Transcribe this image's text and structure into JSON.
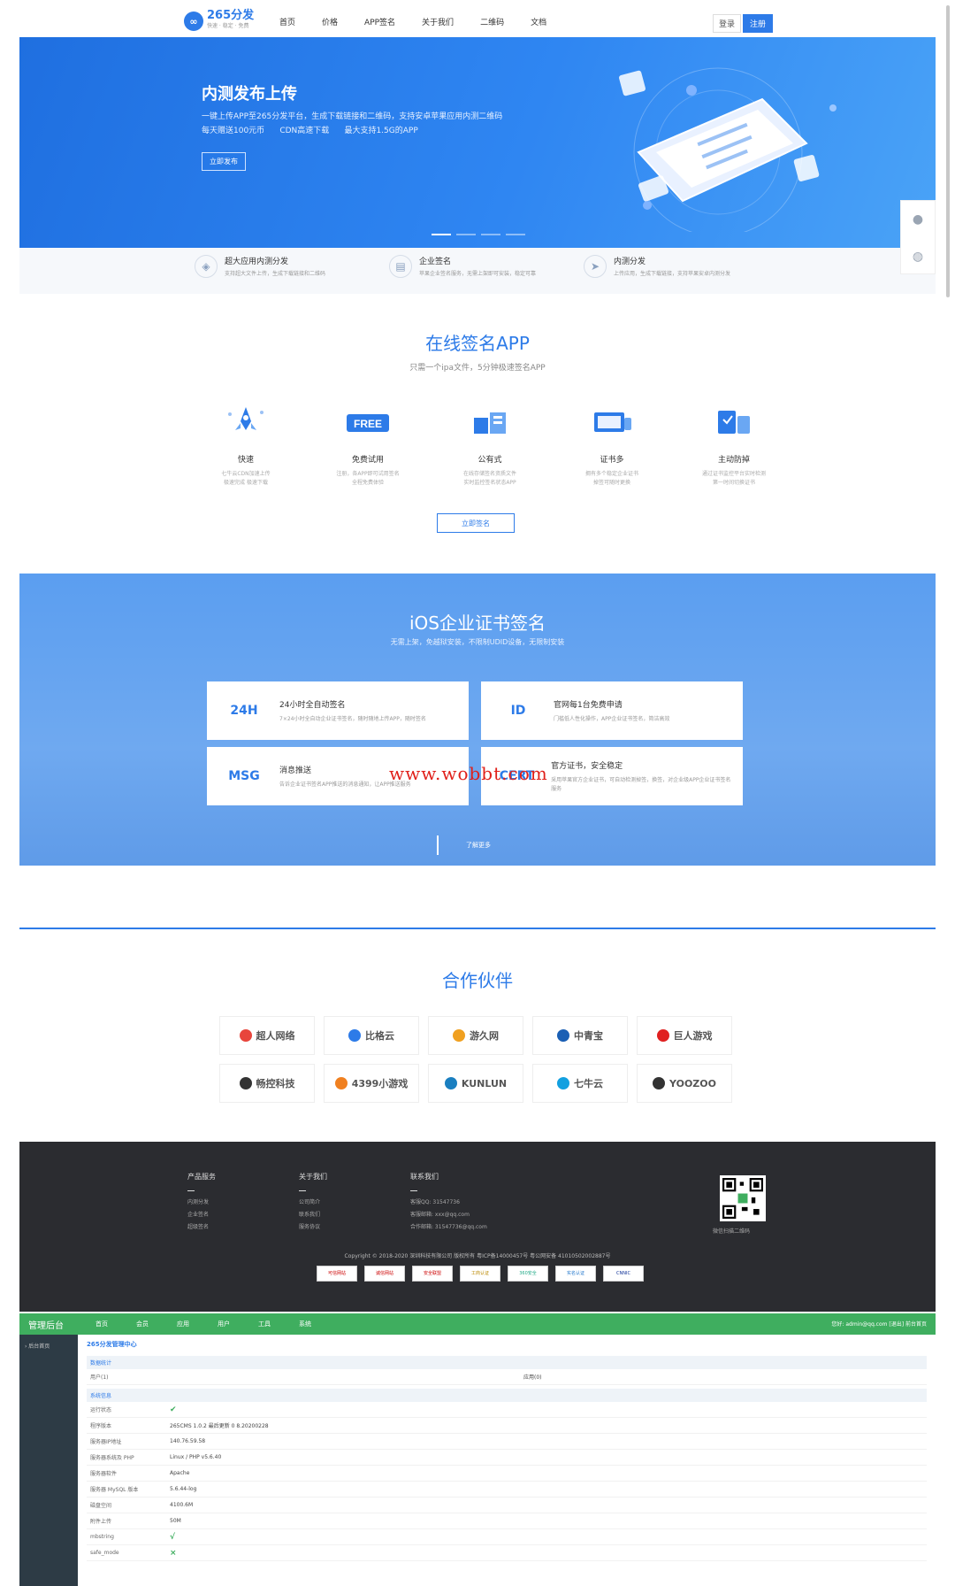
{
  "nav": {
    "logo_mark": "∞",
    "logo_text": "265分发",
    "logo_sub": "快速 · 稳定 · 免费",
    "links": [
      "首页",
      "价格",
      "APP签名",
      "关于我们",
      "二维码",
      "文档"
    ],
    "login": "登录",
    "register": "注册"
  },
  "banner": {
    "title": "内测发布上传",
    "desc_line1": "一键上传APP至265分发平台，生成下载链接和二维码，支持安卓苹果应用内测二维码",
    "desc_line2": "每天赠送100元币      CDN高速下载      最大支持1.5G的APP",
    "button": "立即发布"
  },
  "features": [
    {
      "title": "超大应用内测分发",
      "sub": "支持超大文件上传，生成下载链接和二维码",
      "icon": "layers-icon"
    },
    {
      "title": "企业签名",
      "sub": "苹果企业签名服务，无需上架即可安装，稳定可靠",
      "icon": "document-icon"
    },
    {
      "title": "内测分发",
      "sub": "上传应用，生成下载链接，支持苹果安卓内测分发",
      "icon": "send-icon"
    }
  ],
  "online_sign": {
    "title": "在线签名APP",
    "subtitle": "只需一个ipa文件，5分钟极速签名APP",
    "items": [
      {
        "title": "快速",
        "sub1": "七牛云CDN加速上传",
        "sub2": "极速完成 极速下载"
      },
      {
        "title": "免费试用",
        "sub1": "注册，各APP即可试用签名",
        "sub2": "全程免费体验"
      },
      {
        "title": "公有式",
        "sub1": "在线存储签名资质文件",
        "sub2": "实时监控签名状态APP"
      },
      {
        "title": "证书多",
        "sub1": "拥有多个稳定企业证书",
        "sub2": "掉签可随时更换"
      },
      {
        "title": "主动防掉",
        "sub1": "通过证书监控平台实时检测",
        "sub2": "第一时间切换证书"
      }
    ],
    "button": "立即签名"
  },
  "ios": {
    "title": "iOS企业证书签名",
    "subtitle": "无需上架，免越狱安装，不限制UDID设备，无限制安装",
    "cards": [
      {
        "badge": "24H",
        "title": "24小时全自动签名",
        "sub": "7×24小时全自动企业证书签名，随时随地上传APP，随时签名"
      },
      {
        "badge": "ID",
        "title": "官网每1台免费申请",
        "sub": "门槛低人性化操作，APP企业证书签名，简洁高效"
      },
      {
        "badge": "MSG",
        "title": "消息推送",
        "sub": "告诉企业证书签名APP推送的消息通知，让APP推送服务"
      },
      {
        "badge": "CERT",
        "title": "官方证书，安全稳定",
        "sub": "采用苹果官方企业证书，可自动检测掉签，换签，对企业级APP企业证书签名服务"
      }
    ],
    "more": "了解更多"
  },
  "watermark": "www.wobbt.com",
  "partners": {
    "title": "合作伙伴",
    "items": [
      {
        "name": "超人网络",
        "color": "#e8453c"
      },
      {
        "name": "比格云",
        "color": "#2d7be8"
      },
      {
        "name": "游久网",
        "color": "#f0a020"
      },
      {
        "name": "中青宝",
        "color": "#1a5fb4"
      },
      {
        "name": "巨人游戏",
        "color": "#e02020"
      },
      {
        "name": "畅控科技",
        "color": "#333333"
      },
      {
        "name": "4399小游戏",
        "color": "#f08020"
      },
      {
        "name": "KUNLUN",
        "color": "#1a7fc0"
      },
      {
        "name": "七牛云",
        "color": "#12a0e0"
      },
      {
        "name": "YOOZOO",
        "color": "#333333"
      }
    ]
  },
  "footer": {
    "cols": [
      {
        "title": "产品服务",
        "items": [
          "内测分发",
          "企业签名",
          "超级签名"
        ]
      },
      {
        "title": "关于我们",
        "items": [
          "公司简介",
          "联系我们",
          "服务协议"
        ]
      },
      {
        "title": "联系我们",
        "items": [
          "客服QQ: 31547736",
          "客服邮箱: xxx@qq.com",
          "合作邮箱: 31547736@qq.com"
        ]
      }
    ],
    "qr_caption": "微信扫描二维码",
    "copyright": "Copyright © 2018-2020 深圳科技有限公司 版权所有 粤ICP备14000457号  粤公网安备 41010502002887号",
    "badges": [
      "可信网站",
      "诚信网站",
      "安全联盟",
      "工商认证",
      "360安全",
      "实名认证",
      "CNNIC"
    ]
  },
  "admin": {
    "brand": "管理后台",
    "menu": [
      "首页",
      "会员",
      "应用",
      "用户",
      "工具",
      "系统"
    ],
    "user": "您好: admin@qq.com [退出]  前台首页",
    "side_item": "› 后台首页",
    "heading": "265分发管理中心",
    "sec1": "数据统计",
    "user_row": {
      "k": "用户(1)",
      "v2": "应用(0)"
    },
    "sec2": "系统信息",
    "rows": [
      {
        "k": "运行状态",
        "v": "✔"
      },
      {
        "k": "程序版本",
        "v": "265CMS 1.0.2 最后更新 0 8.20200228"
      },
      {
        "k": "服务器IP地址",
        "v": "140.76.59.58"
      },
      {
        "k": "服务器系统及 PHP",
        "v": "Linux / PHP v5.6.40"
      },
      {
        "k": "服务器软件",
        "v": "Apache"
      },
      {
        "k": "服务器 MySQL 版本",
        "v": "5.6.44-log"
      },
      {
        "k": "磁盘空间",
        "v": "4100.6M"
      },
      {
        "k": "附件上传",
        "v": "50M"
      },
      {
        "k": "mbstring",
        "v": "√"
      },
      {
        "k": "safe_mode",
        "v": "×"
      }
    ]
  }
}
